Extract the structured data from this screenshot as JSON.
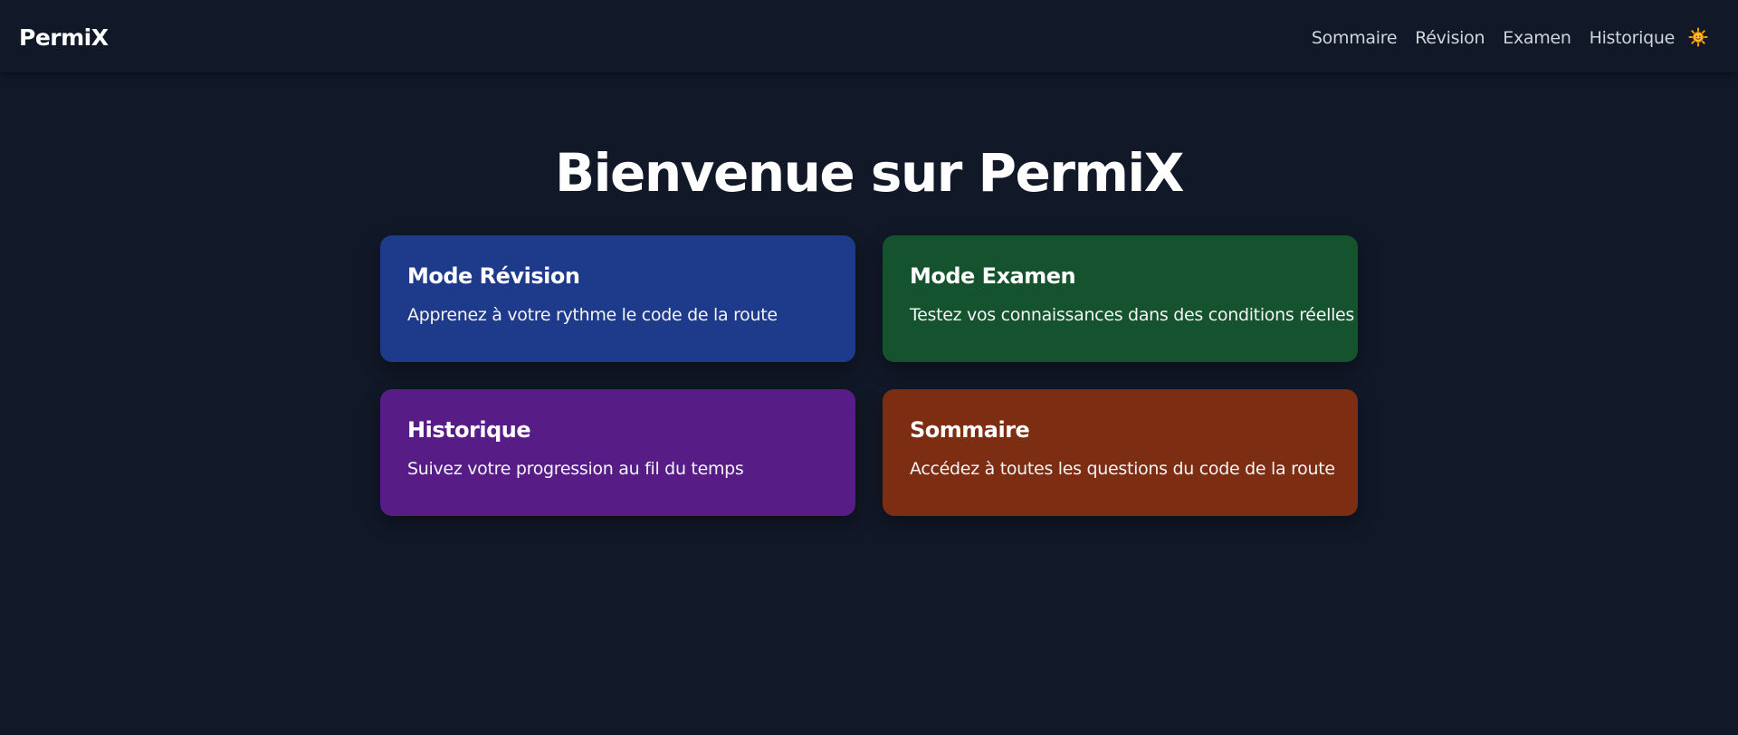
{
  "app": {
    "name": "PermiX"
  },
  "nav": {
    "items": [
      {
        "label": "Sommaire"
      },
      {
        "label": "Révision"
      },
      {
        "label": "Examen"
      },
      {
        "label": "Historique"
      }
    ],
    "theme_toggle_icon": "sun-icon"
  },
  "hero": {
    "title": "Bienvenue sur PermiX"
  },
  "cards": [
    {
      "title": "Mode Révision",
      "description": "Apprenez à votre rythme le code de la route",
      "color": "#1e3a8a"
    },
    {
      "title": "Mode Examen",
      "description": "Testez vos connaissances dans des conditions réelles",
      "color": "#14532d"
    },
    {
      "title": "Historique",
      "description": "Suivez votre progression au fil du temps",
      "color": "#581c87"
    },
    {
      "title": "Sommaire",
      "description": "Accédez à toutes les questions du code de la route",
      "color": "#7c2d12"
    }
  ],
  "colors": {
    "background": "#111827",
    "nav_text": "#d1d5db",
    "sun": "#f59e0b"
  }
}
